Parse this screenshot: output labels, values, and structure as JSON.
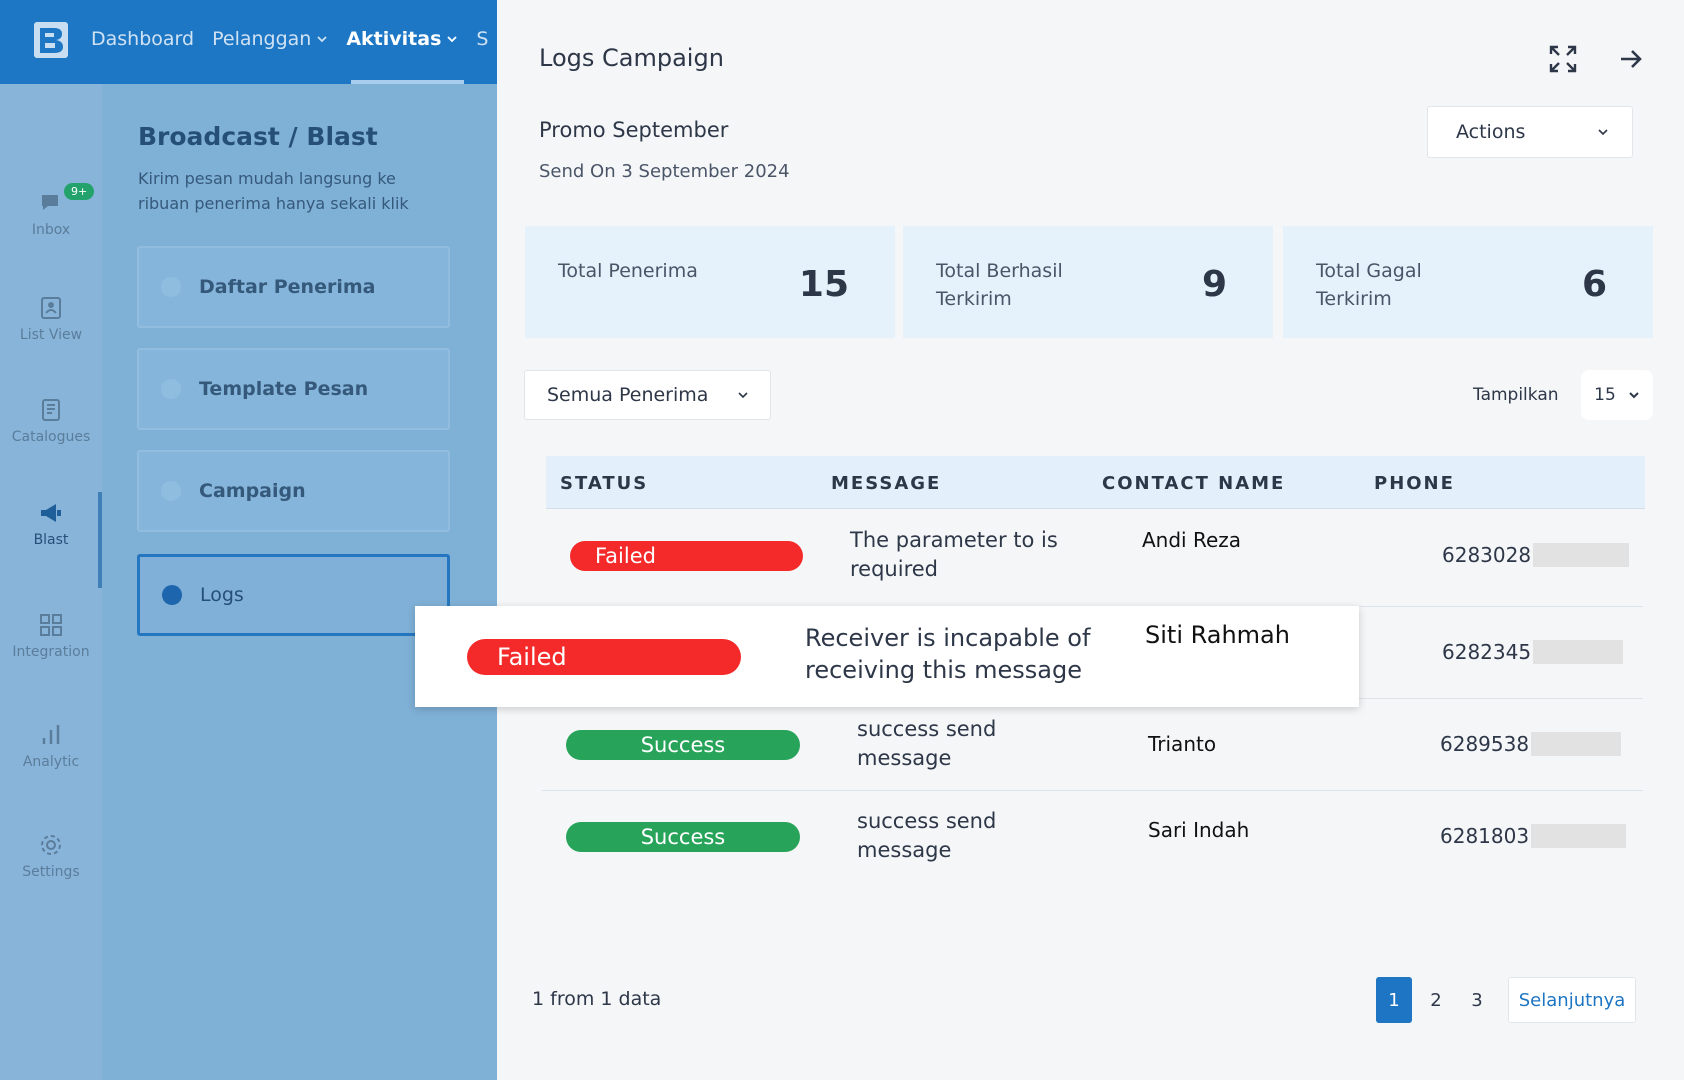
{
  "topnav": {
    "items": [
      {
        "label": "Dashboard"
      },
      {
        "label": "Pelanggan"
      },
      {
        "label": "Aktivitas"
      },
      {
        "label": "S"
      }
    ]
  },
  "rail": {
    "inbox_badge": "9+",
    "items": [
      {
        "label": "Inbox"
      },
      {
        "label": "List View"
      },
      {
        "label": "Catalogues"
      },
      {
        "label": "Blast"
      },
      {
        "label": "Integration"
      },
      {
        "label": "Analytic"
      },
      {
        "label": "Settings"
      }
    ]
  },
  "panel": {
    "title": "Broadcast / Blast",
    "subtitle": "Kirim pesan mudah langsung ke ribuan penerima hanya sekali klik",
    "menu": [
      {
        "label": "Daftar Penerima"
      },
      {
        "label": "Template Pesan"
      },
      {
        "label": "Campaign"
      },
      {
        "label": "Logs"
      }
    ]
  },
  "drawer": {
    "title": "Logs Campaign",
    "campaign_name": "Promo September",
    "campaign_date": "Send On 3 September 2024",
    "actions_label": "Actions",
    "stats": [
      {
        "label": "Total Penerima",
        "value": "15"
      },
      {
        "label": "Total Berhasil Terkirim",
        "value": "9"
      },
      {
        "label": "Total Gagal Terkirim",
        "value": "6"
      }
    ],
    "filter_label": "Semua Penerima",
    "show_label": "Tampilkan",
    "per_page": "15",
    "table": {
      "headers": [
        "STATUS",
        "MESSAGE",
        "CONTACT NAME",
        "PHONE"
      ],
      "rows": [
        {
          "status": "Failed",
          "message": "The parameter to is required",
          "contact": "Andi Reza",
          "phone": "6283028"
        },
        {
          "status": "Failed",
          "message": "Receiver is incapable of receiving this message",
          "contact": "Siti Rahmah",
          "phone": "6282345"
        },
        {
          "status": "Success",
          "message": "success send message",
          "contact": "Trianto",
          "phone": "6289538"
        },
        {
          "status": "Success",
          "message": "success send message",
          "contact": "Sari Indah",
          "phone": "6281803"
        }
      ]
    },
    "footer_info": "1 from 1 data",
    "pagination": {
      "pages": [
        "1",
        "2",
        "3"
      ],
      "next_label": "Selanjutnya"
    }
  },
  "colors": {
    "primary": "#1d75c4",
    "failed": "#f42a2a",
    "success": "#27a45a",
    "stat_bg": "#e5f1fb"
  }
}
